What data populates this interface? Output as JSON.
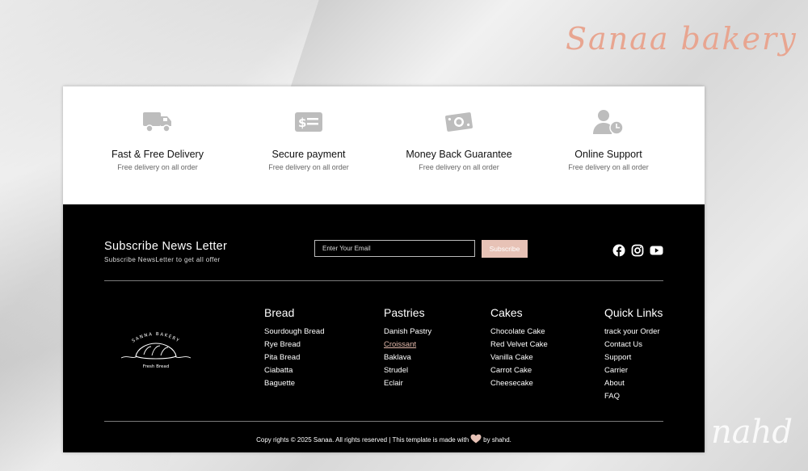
{
  "brand": "Sanaa bakery",
  "watermark": "nahd",
  "features": [
    {
      "icon": "truck-icon",
      "title": "Fast & Free Delivery",
      "subtitle": "Free delivery on all order"
    },
    {
      "icon": "credit-card-icon",
      "title": "Secure payment",
      "subtitle": "Free delivery on all order"
    },
    {
      "icon": "money-icon",
      "title": "Money Back Guarantee",
      "subtitle": "Free delivery on all order"
    },
    {
      "icon": "user-clock-icon",
      "title": "Online Support",
      "subtitle": "Free delivery on all order"
    }
  ],
  "newsletter": {
    "title": "Subscribe News Letter",
    "subtitle": "Subscribe NewsLetter to get all offer",
    "placeholder": "Enter Your Email",
    "button": "Subscribe"
  },
  "social": [
    "facebook-icon",
    "instagram-icon",
    "youtube-icon"
  ],
  "logo": {
    "top_text": "SANNA BAKERY",
    "bottom_text": "Fresh Bread"
  },
  "columns": [
    {
      "title": "Bread",
      "items": [
        "Sourdough Bread",
        "Rye Bread",
        "Pita Bread",
        "Ciabatta",
        "Baguette"
      ]
    },
    {
      "title": "Pastries",
      "items": [
        "Danish Pastry",
        "Croissant",
        "Baklava",
        "Strudel",
        "Eclair"
      ]
    },
    {
      "title": "Cakes",
      "items": [
        "Chocolate Cake",
        "Red Velvet Cake",
        "Vanilla Cake",
        "Carrot Cake",
        "Cheesecake"
      ]
    },
    {
      "title": "Quick Links",
      "items": [
        "track your Order",
        "Contact Us",
        "Support",
        "Carrier",
        "About",
        "FAQ"
      ]
    }
  ],
  "copyright": {
    "before": "Copy rights © 2025 Sanaa. All rights reserved | This template is made with",
    "after": "by shahd."
  },
  "colors": {
    "accent": "#e7c2b6",
    "brand": "#e8a590",
    "footer_bg": "#000000"
  }
}
